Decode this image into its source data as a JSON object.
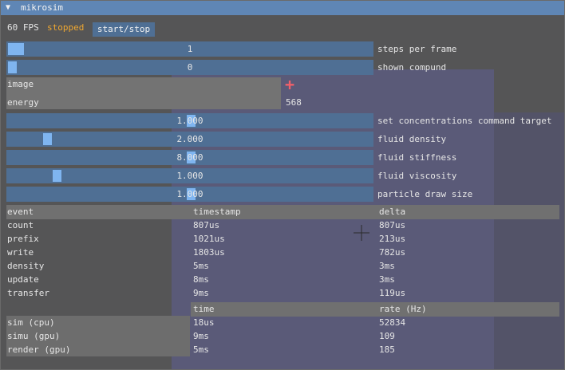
{
  "window": {
    "title": "mikrosim"
  },
  "header": {
    "fps": "60 FPS",
    "status": "stopped",
    "start_stop": "start/stop"
  },
  "sliders": [
    {
      "value": "1",
      "label": "steps per frame",
      "fraction": 0.0
    },
    {
      "value": "0",
      "label": "shown compund",
      "fraction": 0.0
    },
    {
      "value": "1.000",
      "label": "set concentrations command target",
      "fraction": 0.5
    },
    {
      "value": "2.000",
      "label": "fluid density",
      "fraction": 0.1
    },
    {
      "value": "8.000",
      "label": "fluid stiffness",
      "fraction": 0.5
    },
    {
      "value": "1.000",
      "label": "fluid viscosity",
      "fraction": 0.13
    },
    {
      "value": "1.000",
      "label": "particle draw size",
      "fraction": 0.5
    }
  ],
  "list": {
    "items": [
      "image",
      "energy"
    ],
    "energy_value": "568",
    "plus": "+"
  },
  "events": {
    "headers": [
      "event",
      "timestamp",
      "delta"
    ],
    "rows": [
      [
        "count",
        "807us",
        "807us"
      ],
      [
        "prefix",
        "1021us",
        "213us"
      ],
      [
        "write",
        "1803us",
        "782us"
      ],
      [
        "density",
        "5ms",
        "3ms"
      ],
      [
        "update",
        "8ms",
        "3ms"
      ],
      [
        "transfer",
        "9ms",
        "119us"
      ]
    ]
  },
  "rates": {
    "headers": [
      "time",
      "rate (Hz)"
    ],
    "rows": [
      [
        "sim (cpu)",
        "18us",
        "52834"
      ],
      [
        "simu (gpu)",
        "9ms",
        "109"
      ],
      [
        "render (gpu)",
        "5ms",
        "185"
      ]
    ]
  },
  "colors": {
    "accent": "#4f6f94",
    "title": "#5f86b5",
    "stopped": "#f0a830",
    "plus": "#f0606a",
    "grab": "#7fb5f0"
  }
}
